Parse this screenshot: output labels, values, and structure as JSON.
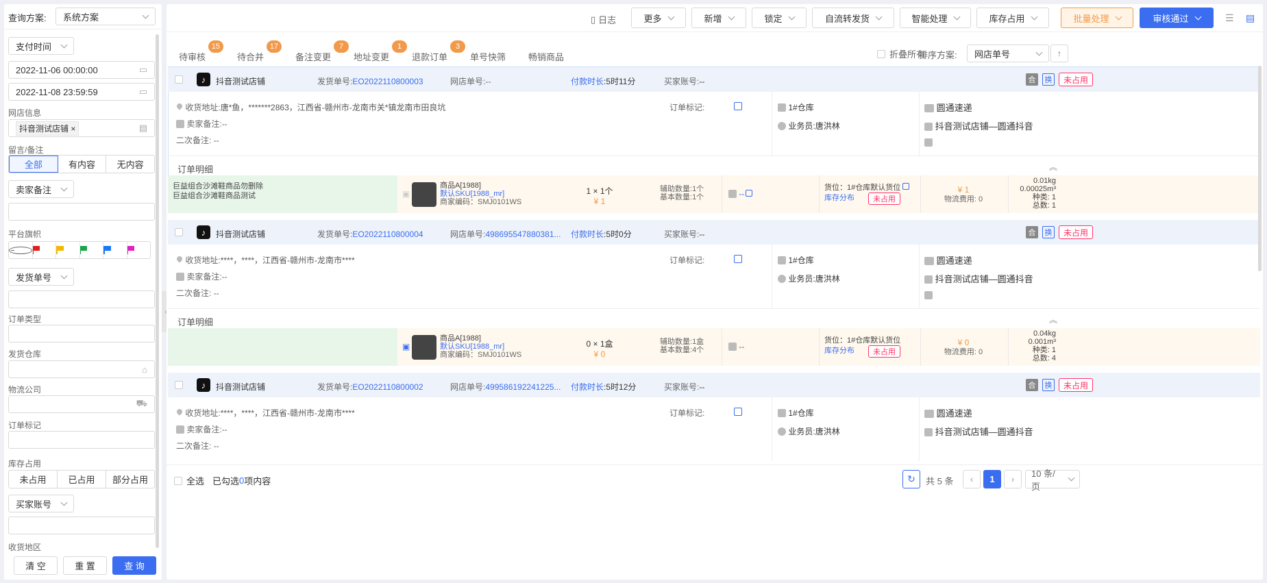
{
  "sidebar": {
    "query_scheme_label": "查询方案:",
    "query_scheme_value": "系统方案",
    "time_type": "支付时间",
    "start_time": "2022-11-06 00:00:00",
    "end_time": "2022-11-08 23:59:59",
    "shop_label": "网店信息",
    "shop_tag": "抖音测试店铺",
    "remark_label": "留言/备注",
    "remark_options": [
      "全部",
      "有内容",
      "无内容"
    ],
    "seller_remark_select": "卖家备注",
    "platform_flag_label": "平台旗帜",
    "flag_colors": [
      "#e02020",
      "#f5b800",
      "#19a64a",
      "#1677ff",
      "#e020c0"
    ],
    "shipment_select": "发货单号",
    "order_type_label": "订单类型",
    "warehouse_label": "发货仓库",
    "logistics_label": "物流公司",
    "order_mark_label": "订单标记",
    "stock_label": "库存占用",
    "stock_options": [
      "未占用",
      "已占用",
      "部分占用"
    ],
    "buyer_select": "买家账号",
    "region_label": "收货地区",
    "btn_clear": "清 空",
    "btn_reset": "重 置",
    "btn_query": "查 询"
  },
  "toolbar": {
    "log": "日志",
    "more": "更多",
    "add": "新增",
    "lock": "锁定",
    "self_ship": "自流转发货",
    "smart": "智能处理",
    "stock": "库存占用",
    "batch": "批量处理",
    "approve": "审核通过"
  },
  "tabs": [
    {
      "label": "待审核",
      "count": "15"
    },
    {
      "label": "待合并",
      "count": "17"
    },
    {
      "label": "备注变更",
      "count": "7"
    },
    {
      "label": "地址变更",
      "count": "1"
    },
    {
      "label": "退款订单",
      "count": "3"
    },
    {
      "label": "单号快筛",
      "count": ""
    },
    {
      "label": "畅销商品",
      "count": ""
    }
  ],
  "fold_all": "折叠所有",
  "sort_label": "排序方案:",
  "sort_value": "网店单号",
  "labels": {
    "ship_no": "发货单号:",
    "shop_no": "网店单号:",
    "pay_time": "付款时长",
    "buyer": "买家账号:",
    "address": "收货地址:",
    "seller_remark": "卖家备注:",
    "second_remark": "二次备注:",
    "order_mark": "订单标记:",
    "salesman": "业务员:",
    "detail": "订单明细",
    "unused": "未占用",
    "he": "合",
    "huan": "换",
    "stock_dist": "库存分布",
    "aux_qty": "辅助数量:",
    "base_qty": "基本数量:",
    "freight": "物流费用:",
    "kinds": "种类:",
    "total": "总数:",
    "dash": "--"
  },
  "orders": [
    {
      "shop": "抖音测试店铺",
      "ship_no": "EO2022110800003",
      "shop_no": "--",
      "pay_time": ":5时11分",
      "buyer": "--",
      "address": "唐*鱼，*******2863，江西省-赣州市-龙南市关*镇龙南市田良坑",
      "seller_remark": "--",
      "second_remark": "--",
      "warehouse": "1#仓库",
      "salesman": "唐洪林",
      "express": "圆通速递",
      "channel": "抖音测试店铺—圆通抖音",
      "combo": [
        "巨益组合沙滩鞋商品勿删除",
        "巨益组合沙滩鞋商品测试"
      ],
      "item": {
        "name": "商品A[1988]",
        "sku": "默认SKU[1988_mr]",
        "code": "商家编码：SMJ0101WS",
        "qty": "1 × 1个",
        "price": "¥ 1",
        "aux": "1个",
        "base": "1个",
        "msg": "--",
        "loc": "货位：1#仓库默认货位",
        "amount": "¥ 1",
        "freight": "0",
        "weight": "0.01kg",
        "volume": "0.00025m³",
        "kinds": "1",
        "total": "1"
      }
    },
    {
      "shop": "抖音测试店铺",
      "ship_no": "EO2022110800004",
      "shop_no": "498695547880381...",
      "pay_time": ":5时0分",
      "buyer": "--",
      "address": "****，****，江西省-赣州市-龙南市****",
      "seller_remark": "--",
      "second_remark": "--",
      "warehouse": "1#仓库",
      "salesman": "唐洪林",
      "express": "圆通速递",
      "channel": "抖音测试店铺—圆通抖音",
      "combo": [],
      "item": {
        "name": "商品A[1988]",
        "sku": "默认SKU[1988_mr]",
        "code": "商家编码：SMJ0101WS",
        "qty": "0 × 1盒",
        "price": "¥ 0",
        "aux": "1盒",
        "base": "4个",
        "msg": "--",
        "loc": "货位：1#仓库默认货位",
        "amount": "¥ 0",
        "freight": "0",
        "weight": "0.04kg",
        "volume": "0.001m³",
        "kinds": "1",
        "total": "4"
      }
    },
    {
      "shop": "抖音测试店铺",
      "ship_no": "EO2022110800002",
      "shop_no": "499586192241225...",
      "pay_time": ":5时12分",
      "buyer": "--",
      "address": "****，****，江西省-赣州市-龙南市****",
      "seller_remark": "--",
      "second_remark": "--",
      "warehouse": "1#仓库",
      "salesman": "唐洪林",
      "express": "圆通速递",
      "channel": "抖音测试店铺—圆通抖音"
    }
  ],
  "footer": {
    "select_all": "全选",
    "selected_prefix": "已勾选",
    "selected_count": "0",
    "selected_suffix": "项内容",
    "total": "共 5 条",
    "page": "1",
    "page_size": "10 条/页"
  }
}
